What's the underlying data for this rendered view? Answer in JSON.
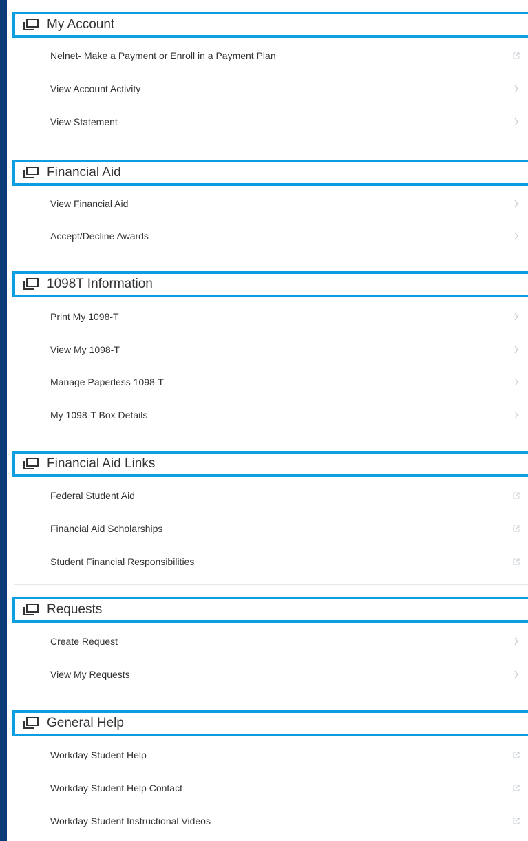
{
  "sections": [
    {
      "title": "My Account",
      "icon": "window-icon",
      "items": [
        {
          "label": "Nelnet- Make a Payment or Enroll in a Payment Plan",
          "icon": "external-link-icon"
        },
        {
          "label": "View Account Activity",
          "icon": "chevron-right-icon"
        },
        {
          "label": "View Statement",
          "icon": "chevron-right-icon"
        }
      ]
    },
    {
      "title": "Financial Aid",
      "icon": "window-icon",
      "items": [
        {
          "label": "View Financial Aid",
          "icon": "chevron-right-icon"
        },
        {
          "label": "Accept/Decline Awards",
          "icon": "chevron-right-icon"
        }
      ]
    },
    {
      "title": "1098T Information",
      "icon": "window-icon",
      "items": [
        {
          "label": "Print My 1098-T",
          "icon": "chevron-right-icon"
        },
        {
          "label": "View My 1098-T",
          "icon": "chevron-right-icon"
        },
        {
          "label": "Manage Paperless 1098-T",
          "icon": "chevron-right-icon"
        },
        {
          "label": "My 1098-T Box Details",
          "icon": "chevron-right-icon"
        }
      ]
    },
    {
      "title": "Financial Aid Links",
      "icon": "window-icon",
      "items": [
        {
          "label": "Federal Student Aid",
          "icon": "external-link-icon"
        },
        {
          "label": "Financial Aid Scholarships",
          "icon": "external-link-icon"
        },
        {
          "label": "Student Financial Responsibilities",
          "icon": "external-link-icon"
        }
      ]
    },
    {
      "title": "Requests",
      "icon": "window-icon",
      "items": [
        {
          "label": "Create Request",
          "icon": "chevron-right-icon"
        },
        {
          "label": "View My Requests",
          "icon": "chevron-right-icon"
        }
      ]
    },
    {
      "title": "General Help",
      "icon": "window-icon",
      "items": [
        {
          "label": "Workday Student Help",
          "icon": "external-link-icon"
        },
        {
          "label": "Workday Student Help Contact",
          "icon": "external-link-icon"
        },
        {
          "label": "Workday Student Instructional Videos",
          "icon": "external-link-icon"
        }
      ]
    }
  ],
  "colors": {
    "highlight_border": "#0b9fe2",
    "left_frame": "#0d3a78",
    "text": "#333333",
    "arrow": "#c7ccd2",
    "divider": "#e5e8ec"
  }
}
